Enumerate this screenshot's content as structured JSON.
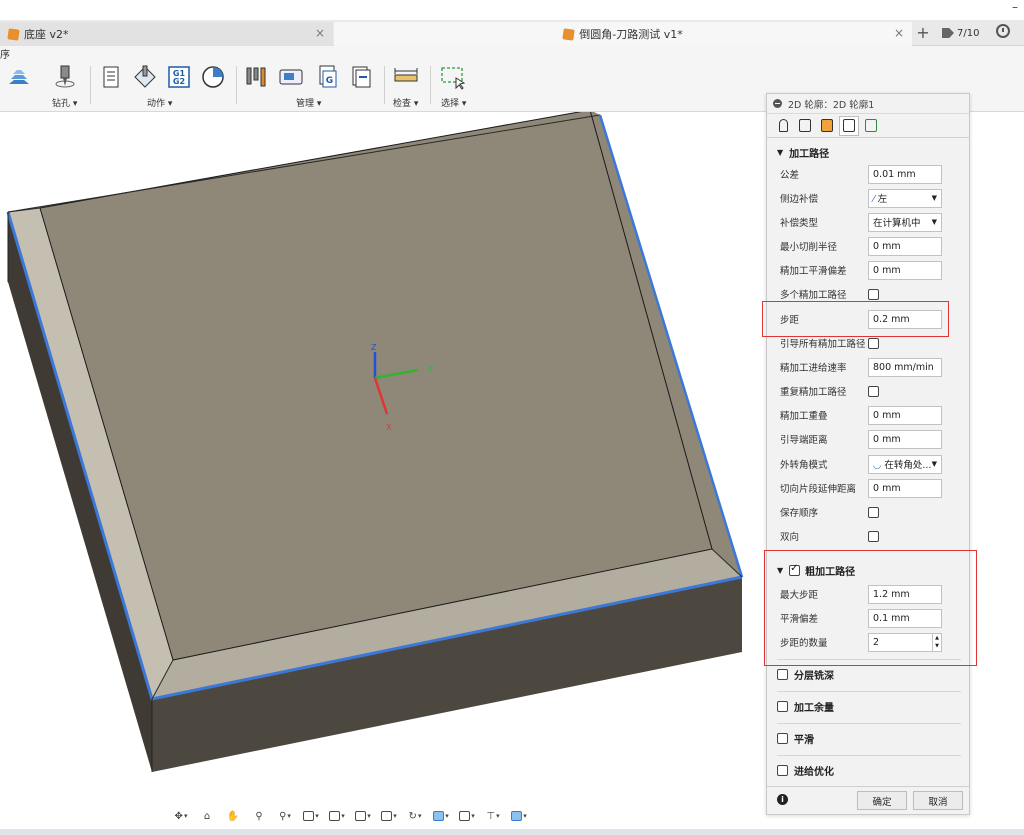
{
  "window": {
    "minimize_label": "–"
  },
  "tabs": [
    {
      "label": "底座 v2*",
      "close": "×"
    },
    {
      "label": "倒圆角-刀路测试 v1*",
      "close": "×"
    }
  ],
  "tab_add": "+",
  "jobs": {
    "count": "7/10"
  },
  "ribbon": {
    "sequence_label": "序",
    "groups": [
      {
        "label": "钻孔 ▾"
      },
      {
        "label": "动作 ▾"
      },
      {
        "label": "管理 ▾"
      },
      {
        "label": "检查 ▾"
      },
      {
        "label": "选择 ▾"
      }
    ],
    "g1g2_text": "G1\nG2"
  },
  "axes": {
    "z": "Z",
    "x": "X",
    "y": "Y"
  },
  "panel": {
    "title": "2D 轮廓：2D 轮廓1",
    "section_passes": "加工路径",
    "fields": {
      "tolerance": {
        "label": "公差",
        "value": "0.01 mm"
      },
      "compensation": {
        "label": "侧边补偿",
        "value": "左"
      },
      "comp_type": {
        "label": "补偿类型",
        "value": "在计算机中"
      },
      "min_radius": {
        "label": "最小切削半径",
        "value": "0 mm"
      },
      "finish_smooth": {
        "label": "精加工平滑偏差",
        "value": "0 mm"
      },
      "multi_finish": {
        "label": "多个精加工路径"
      },
      "stepover": {
        "label": "步距",
        "value": "0.2 mm"
      },
      "lead_all": {
        "label": "引导所有精加工路径"
      },
      "finish_feed": {
        "label": "精加工进给速率",
        "value": "800 mm/min"
      },
      "repeat_finish": {
        "label": "重复精加工路径"
      },
      "finish_overlap": {
        "label": "精加工重叠",
        "value": "0 mm"
      },
      "lead_end": {
        "label": "引导端距离",
        "value": "0 mm"
      },
      "corner_mode": {
        "label": "外转角模式",
        "value": "在转角处..."
      },
      "tangent_ext": {
        "label": "切向片段延伸距离",
        "value": "0 mm"
      },
      "keep_order": {
        "label": "保存顺序"
      },
      "both_ways": {
        "label": "双向"
      }
    },
    "section_rough": "粗加工路径",
    "rough": {
      "max_stepover": {
        "label": "最大步距",
        "value": "1.2 mm"
      },
      "smooth_dev": {
        "label": "平滑偏差",
        "value": "0.1 mm"
      },
      "num_steps": {
        "label": "步距的数量",
        "value": "2"
      }
    },
    "collapsed": [
      {
        "label": "分层铣深"
      },
      {
        "label": "加工余量"
      },
      {
        "label": "平滑"
      },
      {
        "label": "进给优化"
      }
    ],
    "ok": "确定",
    "cancel": "取消",
    "info": "i"
  },
  "colors": {
    "accent_red": "#e03535",
    "edge_blue": "#3b78d8",
    "part_top": "#8e8778",
    "part_side": "#4b463e"
  }
}
